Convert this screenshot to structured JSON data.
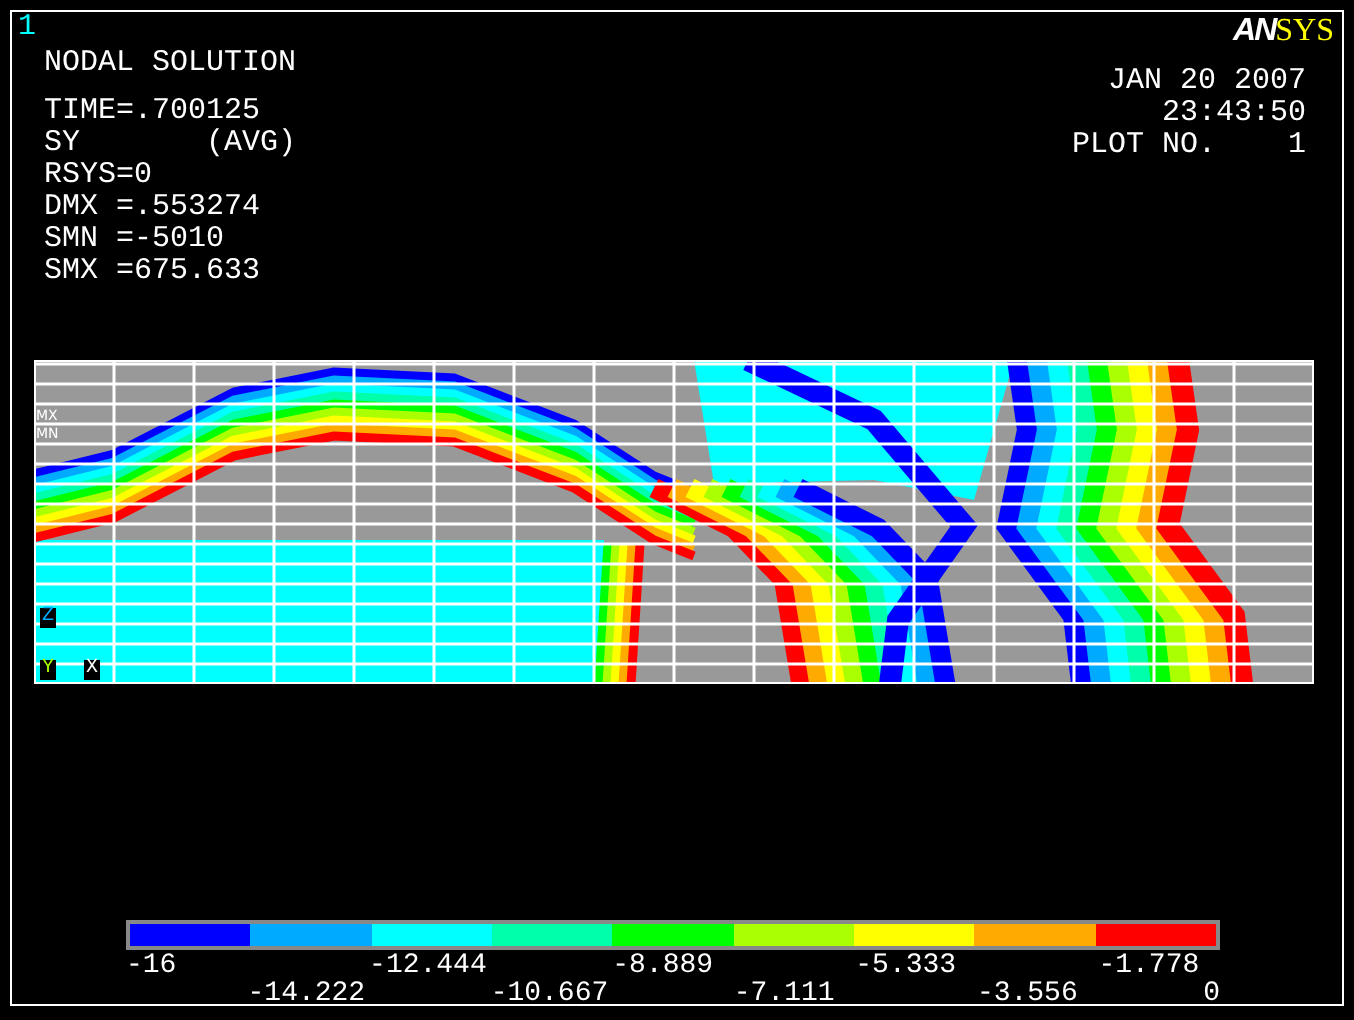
{
  "window_number": "1",
  "logo": {
    "part_1": "AN",
    "part_2": "SYS"
  },
  "title": "NODAL SOLUTION",
  "info_lines": [
    "TIME=.700125",
    "SY       (AVG)",
    "RSYS=0",
    "DMX =.553274",
    "SMN =-5010",
    "SMX =675.633"
  ],
  "stamp_lines": [
    "JAN 20 2007",
    "23:43:50",
    "PLOT NO.    1"
  ],
  "plot": {
    "max_label": "MX",
    "min_label": "MN",
    "axis_labels": [
      "Z",
      "Y",
      "X"
    ]
  },
  "legend": {
    "bands": [
      {
        "color": "#0000ff"
      },
      {
        "color": "#00aaff"
      },
      {
        "color": "#00ffff"
      },
      {
        "color": "#00ffaa"
      },
      {
        "color": "#00ff00"
      },
      {
        "color": "#aaff00"
      },
      {
        "color": "#ffff00"
      },
      {
        "color": "#ffaa00"
      },
      {
        "color": "#ff0000"
      }
    ],
    "labels": [
      "-16",
      "-14.222",
      "-12.444",
      "-10.667",
      "-8.889",
      "-7.111",
      "-5.333",
      "-3.556",
      "-1.778",
      "0"
    ]
  }
}
